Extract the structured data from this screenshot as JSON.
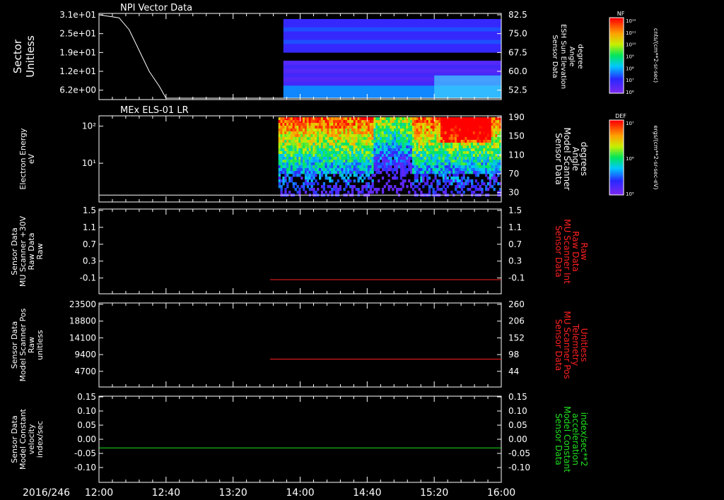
{
  "figure": {
    "date_label": "2016/246",
    "time_ticks": [
      "12:00",
      "12:40",
      "13:20",
      "14:00",
      "14:40",
      "15:20",
      "16:00"
    ],
    "colors": {
      "background": "#000000",
      "axis": "#ffffff",
      "red_trace": "#ff2020",
      "green_trace": "#20e020"
    }
  },
  "colorbars": [
    {
      "label": "NF",
      "units": "cnts/(cm**2-sr-sec)",
      "ticks": [
        "10¹²",
        "10¹¹",
        "10¹⁰",
        "10⁹",
        "10⁸",
        "10⁷",
        "10⁶"
      ]
    },
    {
      "label": "DEF",
      "units": "ergs/(cm**2-sr-sec-eV)",
      "ticks": [
        "10⁷",
        "10⁶",
        "10⁵"
      ]
    }
  ],
  "chart_data": [
    {
      "type": "heatmap",
      "title": "NPI Vector Data",
      "ylabel_lines": [
        "Sector",
        "Unitless"
      ],
      "y_ticks": [
        "3.1e+01",
        "2.5e+01",
        "1.9e+01",
        "1.2e+01",
        "6.2e+00"
      ],
      "ylabel_right_lines": [
        "Sensor Data",
        "ESH Sun Elevation",
        "Angle",
        "degree"
      ],
      "y_right_ticks": [
        "82.5",
        "75.0",
        "67.5",
        "60.0",
        "52.5"
      ],
      "x_range": [
        "12:00",
        "16:00"
      ],
      "data_start": "13:50",
      "line_series": {
        "name": "",
        "points": [
          [
            0,
            31
          ],
          [
            12,
            30
          ],
          [
            18,
            26
          ],
          [
            24,
            19
          ],
          [
            30,
            12
          ],
          [
            36,
            7
          ],
          [
            40,
            3
          ],
          [
            45,
            3
          ],
          [
            240,
            3
          ]
        ]
      }
    },
    {
      "type": "heatmap",
      "title": "MEx ELS-01 LR",
      "ylabel_lines": [
        "Electron Energy",
        "eV"
      ],
      "y_ticks": [
        "10²",
        "10¹"
      ],
      "ylabel_right_lines": [
        "Sensor Data",
        "Model Scanner",
        "Angle",
        "degrees"
      ],
      "y_right_ticks": [
        "190",
        "150",
        "110",
        "70",
        "30"
      ],
      "x_range": [
        "12:00",
        "16:00"
      ],
      "data_start": "13:47"
    },
    {
      "type": "line",
      "ylabel_lines": [
        "Sensor Data",
        "MU Scanner +30V",
        "Raw Data",
        "Raw"
      ],
      "y_ticks": [
        "1.5",
        "1.1",
        "0.7",
        "0.3",
        "-0.1"
      ],
      "ylabel_right_lines": [
        "Sensor Data",
        "MU Scanner Int",
        "Raw Data",
        "Raw"
      ],
      "y_right_ticks": [
        "1.5",
        "1.1",
        "0.7",
        "0.3",
        "-0.1"
      ],
      "ylim": [
        -0.3,
        1.5
      ],
      "series": [
        {
          "name": "",
          "x_start_min": 102,
          "x_end_min": 240,
          "value": 0.0,
          "color": "#ff2020"
        }
      ]
    },
    {
      "type": "line",
      "ylabel_lines": [
        "Sensor Data",
        "Model Scanner Pos",
        "Raw",
        "unitless"
      ],
      "y_ticks": [
        "23500",
        "18800",
        "14100",
        "9400",
        "4700"
      ],
      "ylabel_right_lines": [
        "Sensor Data",
        "MU Scanner Pos",
        "Telemetry",
        "Unitless"
      ],
      "y_right_ticks": [
        "260",
        "206",
        "152",
        "98",
        "44"
      ],
      "ylim": [
        0,
        23500
      ],
      "series": [
        {
          "name": "",
          "x_start_min": 102,
          "x_end_min": 240,
          "value": 7800,
          "color": "#ff2020"
        }
      ]
    },
    {
      "type": "line",
      "ylabel_lines": [
        "Sensor Data",
        "Model Constant",
        "velocity",
        "index/sec"
      ],
      "y_ticks": [
        "0.15",
        "0.10",
        "0.05",
        "0.00",
        "-0.05",
        "-0.10"
      ],
      "ylabel_right_lines": [
        "Sensor Data",
        "Model Constant",
        "acceleration",
        "index/sec**2"
      ],
      "y_right_ticks": [
        "0.15",
        "0.10",
        "0.05",
        "0.00",
        "-0.05",
        "-0.10"
      ],
      "ylim": [
        -0.1,
        0.15
      ],
      "series": [
        {
          "name": "",
          "x_start_min": 0,
          "x_end_min": 240,
          "value": 0.0,
          "color": "#20e020"
        }
      ]
    }
  ]
}
